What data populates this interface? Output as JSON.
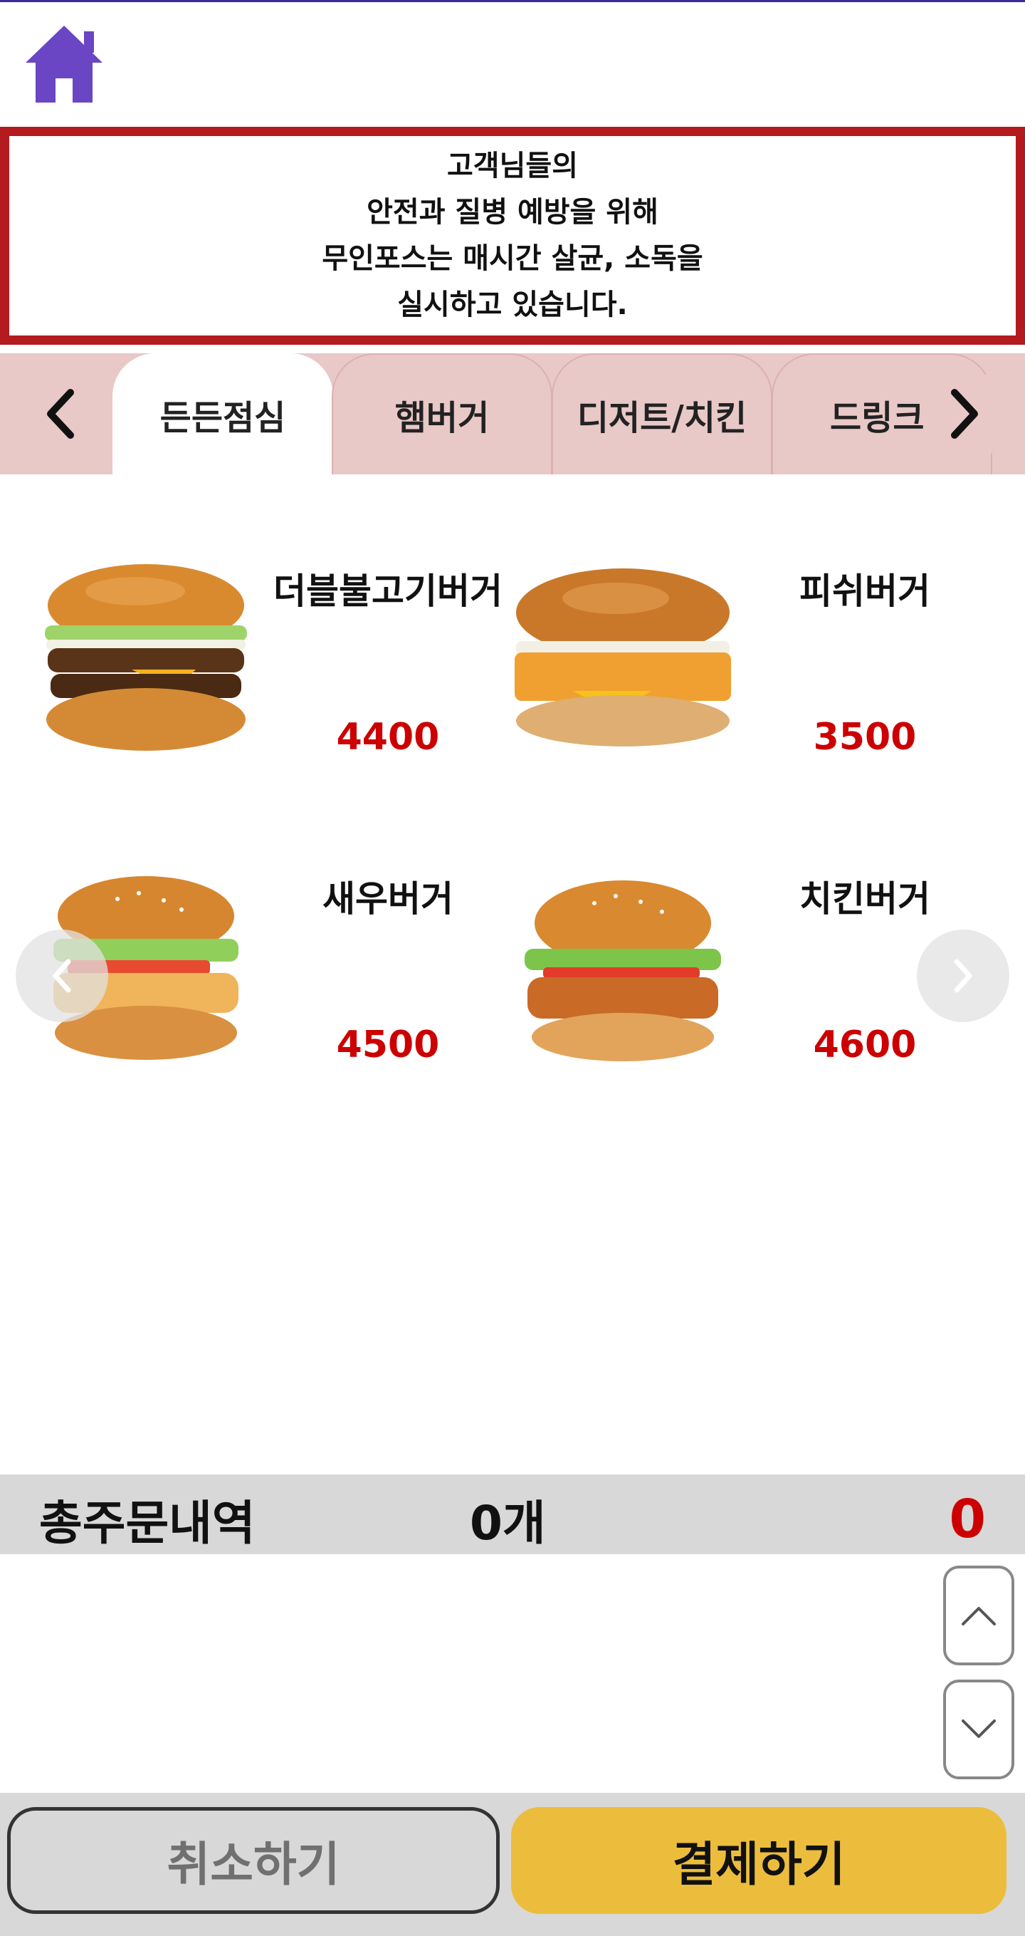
{
  "notice": {
    "lines": [
      "고객님들의",
      "안전과 질병 예방을 위해",
      "무인포스는 매시간 살균, 소독을",
      "실시하고 있습니다."
    ]
  },
  "tabs": [
    {
      "label": "든든점심",
      "active": true
    },
    {
      "label": "햄버거",
      "active": false
    },
    {
      "label": "디저트/치킨",
      "active": false
    },
    {
      "label": "드링크",
      "active": false
    }
  ],
  "products": [
    {
      "name": "더블불고기버거",
      "price": "4400",
      "icon": "double-bulgogi-burger-image"
    },
    {
      "name": "피쉬버거",
      "price": "3500",
      "icon": "fish-burger-image"
    },
    {
      "name": "새우버거",
      "price": "4500",
      "icon": "shrimp-burger-image"
    },
    {
      "name": "치킨버거",
      "price": "4600",
      "icon": "chicken-burger-image"
    }
  ],
  "summary": {
    "label": "총주문내역",
    "count": "0개",
    "total": "0"
  },
  "buttons": {
    "cancel": "취소하기",
    "pay": "결제하기"
  },
  "colors": {
    "accent_red": "#cc0000",
    "notice_border": "#b31b1f",
    "tab_bar": "#e9c8c8",
    "pay_button": "#ecbd3c",
    "home_icon": "#6a45c4"
  }
}
